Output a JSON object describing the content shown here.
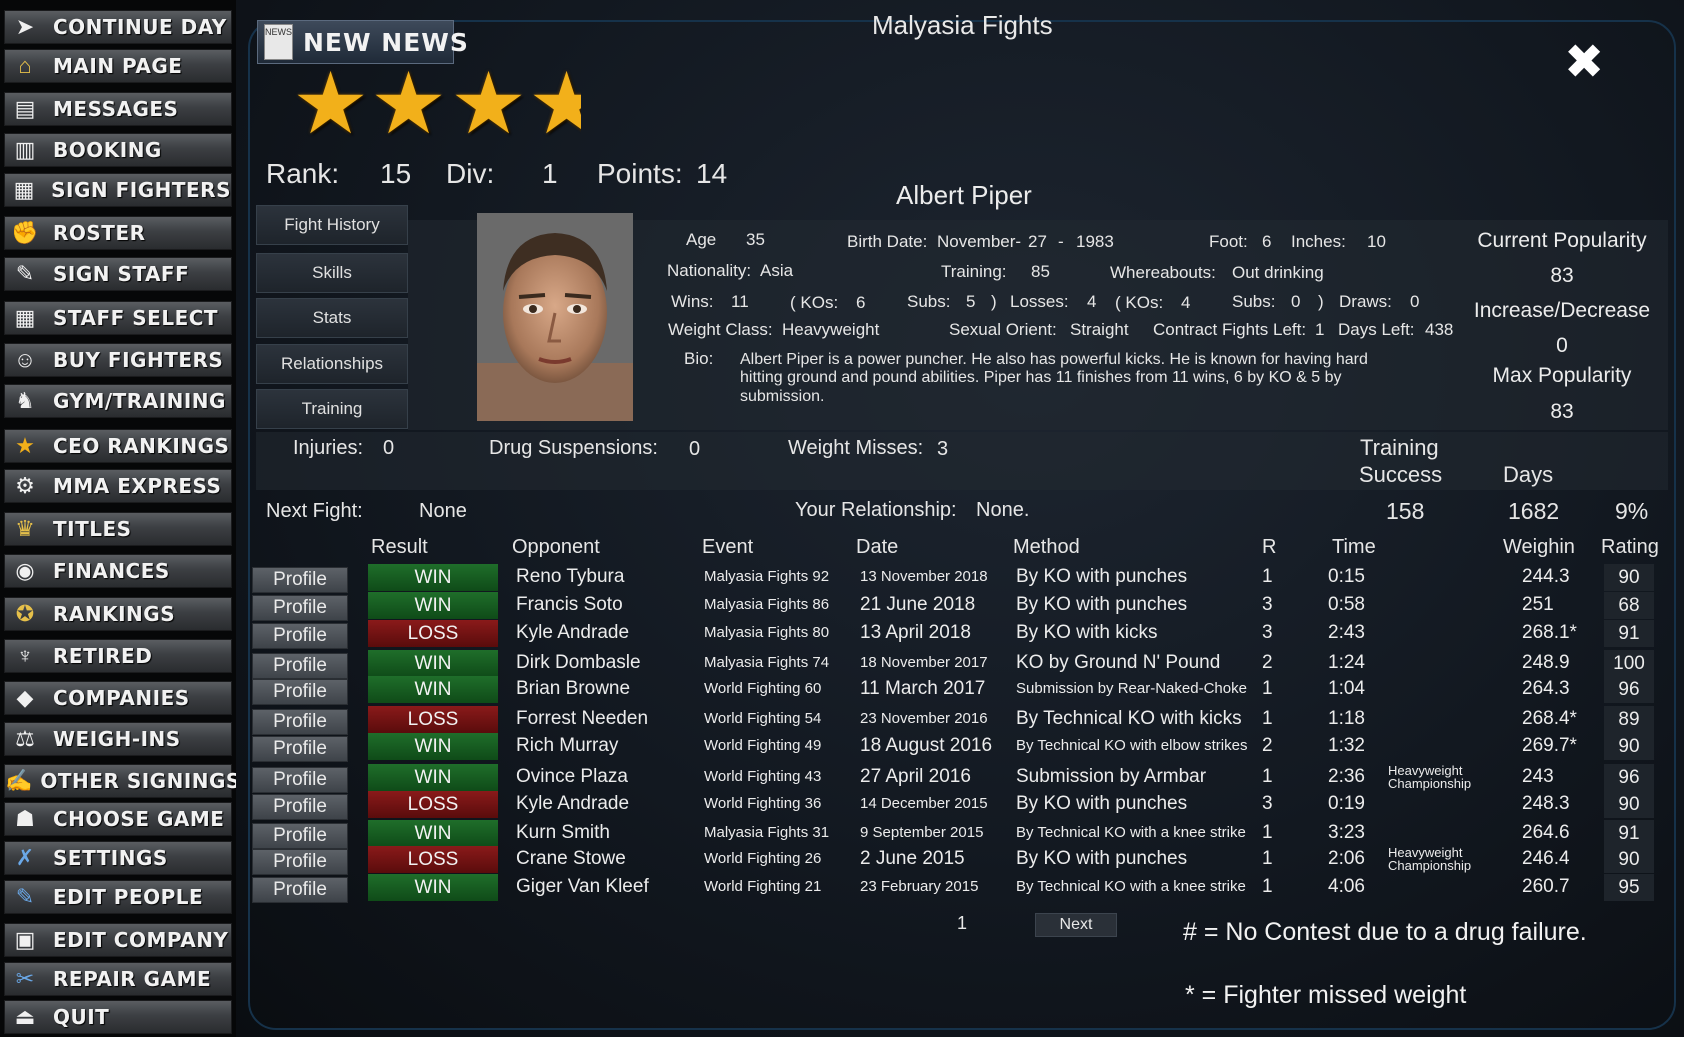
{
  "sidebar": [
    {
      "label": "CONTINUE DAY",
      "icon": "play-arrow-icon"
    },
    {
      "label": "MAIN PAGE",
      "icon": "home-icon"
    },
    {
      "label": "MESSAGES",
      "icon": "newspaper-icon"
    },
    {
      "label": "BOOKING",
      "icon": "clipboard-icon"
    },
    {
      "label": "SIGN FIGHTERS",
      "icon": "contract-icon"
    },
    {
      "label": "ROSTER",
      "icon": "fighter-icon"
    },
    {
      "label": "SIGN STAFF",
      "icon": "pen-icon"
    },
    {
      "label": "STAFF SELECT",
      "icon": "building-icon"
    },
    {
      "label": "BUY FIGHTERS",
      "icon": "portrait-icon"
    },
    {
      "label": "GYM/TRAINING",
      "icon": "gym-icon"
    },
    {
      "label": "CEO RANKINGS",
      "icon": "star-icon"
    },
    {
      "label": "MMA EXPRESS",
      "icon": "gear-icon"
    },
    {
      "label": "TITLES",
      "icon": "trophy-icon"
    },
    {
      "label": "FINANCES",
      "icon": "money-icon"
    },
    {
      "label": "RANKINGS",
      "icon": "medal-icon"
    },
    {
      "label": "RETIRED",
      "icon": "cocktail-icon"
    },
    {
      "label": "COMPANIES",
      "icon": "cube-icon"
    },
    {
      "label": "WEIGH-INS",
      "icon": "scale-icon"
    },
    {
      "label": "OTHER SIGNINGS",
      "icon": "signing-icon"
    },
    {
      "label": "CHOOSE GAME",
      "icon": "person-icon"
    },
    {
      "label": "SETTINGS",
      "icon": "wrench-icon"
    },
    {
      "label": "EDIT PEOPLE",
      "icon": "edit-icon"
    },
    {
      "label": "EDIT COMPANY",
      "icon": "company-icon"
    },
    {
      "label": "REPAIR GAME",
      "icon": "repair-icon"
    },
    {
      "label": "QUIT",
      "icon": "exit-icon"
    }
  ],
  "header": {
    "title": "Malyasia Fights",
    "news_label": "NEW NEWS",
    "news_icon_text": "NEWS"
  },
  "rating_stars": 4,
  "rank": {
    "rank_label": "Rank:",
    "rank": "15",
    "div_label": "Div:",
    "div": "1",
    "points_label": "Points:",
    "points": "14"
  },
  "fighter": {
    "name": "Albert Piper",
    "age_label": "Age",
    "age": "35",
    "birth_label": "Birth Date:",
    "birth_month": "November-",
    "birth_day": "27",
    "birth_sep": "-",
    "birth_year": "1983",
    "foot_label": "Foot:",
    "foot": "6",
    "inches_label": "Inches:",
    "inches": "10",
    "nationality_label": "Nationality:",
    "nationality": "Asia",
    "training_label": "Training:",
    "training": "85",
    "whereabouts_label": "Whereabouts:",
    "whereabouts": "Out drinking",
    "wins_label": "Wins:",
    "wins": "11",
    "wko_label": "( KOs:",
    "wko": "6",
    "wsub_label": "Subs:",
    "wsub": "5",
    "close_paren": ")",
    "losses_label": "Losses:",
    "losses": "4",
    "lko_label": "( KOs:",
    "lko": "4",
    "lsub_label": "Subs:",
    "lsub": "0",
    "draws_label": "Draws:",
    "draws": "0",
    "weightclass_label": "Weight Class:",
    "weightclass": "Heavyweight",
    "orient_label": "Sexual Orient:",
    "orient": "Straight",
    "contract_label": "Contract Fights Left:",
    "contract": "1",
    "days_label": "Days Left:",
    "days": "438",
    "bio_label": "Bio:",
    "bio_1": "Albert Piper is a power puncher. He also has powerful kicks. He is known for having hard",
    "bio_2": "hitting ground and pound abilities. Piper has 11 finishes from 11 wins, 6 by KO & 5 by",
    "bio_3": "submission."
  },
  "popularity": {
    "current_label": "Current Popularity",
    "current": "83",
    "change_label": "Increase/Decrease",
    "change": "0",
    "max_label": "Max Popularity",
    "max": "83"
  },
  "tabs": [
    "Fight History",
    "Skills",
    "Stats",
    "Relationships",
    "Training"
  ],
  "status": {
    "injuries_label": "Injuries:",
    "injuries": "0",
    "drug_label": "Drug Suspensions:",
    "drug": "0",
    "weight_label": "Weight Misses:",
    "weight": "3",
    "training_label_1": "Training",
    "training_label_2": "Success",
    "training_value": "158",
    "days_label": "Days",
    "days_value": "1682",
    "percent": "9%",
    "next_label": "Next Fight:",
    "next": "None",
    "relationship_label": "Your Relationship:",
    "relationship": "None."
  },
  "table": {
    "headers": [
      "Result",
      "Opponent",
      "Event",
      "Date",
      "Method",
      "R",
      "Time",
      "Weighin",
      "Rating"
    ],
    "profile_label": "Profile",
    "rows": [
      {
        "result": "WIN",
        "opponent": "Reno Tybura",
        "event": "Malyasia Fights 92",
        "date": "13 November 2018",
        "method": "By KO with punches",
        "r": "1",
        "time": "0:15",
        "title": "",
        "weighin": "244.3",
        "rating": "90"
      },
      {
        "result": "WIN",
        "opponent": "Francis Soto",
        "event": "Malyasia Fights 86",
        "date": "21 June 2018",
        "method": "By KO with punches",
        "r": "3",
        "time": "0:58",
        "title": "",
        "weighin": "251",
        "rating": "68"
      },
      {
        "result": "LOSS",
        "opponent": "Kyle Andrade",
        "event": "Malyasia Fights 80",
        "date": "13 April 2018",
        "method": "By KO with kicks",
        "r": "3",
        "time": "2:43",
        "title": "",
        "weighin": "268.1*",
        "rating": "91"
      },
      {
        "result": "WIN",
        "opponent": "Dirk Dombasle",
        "event": "Malyasia Fights 74",
        "date": "18 November 2017",
        "method": "KO by Ground N' Pound",
        "r": "2",
        "time": "1:24",
        "title": "",
        "weighin": "248.9",
        "rating": "100"
      },
      {
        "result": "WIN",
        "opponent": "Brian Browne",
        "event": "World Fighting 60",
        "date": "11 March 2017",
        "method": "Submission by Rear-Naked-Choke",
        "r": "1",
        "time": "1:04",
        "title": "",
        "weighin": "264.3",
        "rating": "96"
      },
      {
        "result": "LOSS",
        "opponent": "Forrest Needen",
        "event": "World Fighting 54",
        "date": "23 November 2016",
        "method": "By Technical KO with kicks",
        "r": "1",
        "time": "1:18",
        "title": "",
        "weighin": "268.4*",
        "rating": "89"
      },
      {
        "result": "WIN",
        "opponent": "Rich Murray",
        "event": "World Fighting 49",
        "date": "18 August 2016",
        "method": "By Technical KO with elbow strikes",
        "r": "2",
        "time": "1:32",
        "title": "",
        "weighin": "269.7*",
        "rating": "90"
      },
      {
        "result": "WIN",
        "opponent": "Ovince Plaza",
        "event": "World Fighting 43",
        "date": "27 April 2016",
        "method": "Submission by Armbar",
        "r": "1",
        "time": "2:36",
        "title": "Heavyweight Championship",
        "weighin": "243",
        "rating": "96"
      },
      {
        "result": "LOSS",
        "opponent": "Kyle Andrade",
        "event": "World Fighting 36",
        "date": "14 December 2015",
        "method": "By KO with punches",
        "r": "3",
        "time": "0:19",
        "title": "",
        "weighin": "248.3",
        "rating": "90"
      },
      {
        "result": "WIN",
        "opponent": "Kurn Smith",
        "event": "Malyasia Fights 31",
        "date": "9 September 2015",
        "method": "By Technical KO with a knee strike",
        "r": "1",
        "time": "3:23",
        "title": "",
        "weighin": "264.6",
        "rating": "91"
      },
      {
        "result": "LOSS",
        "opponent": "Crane Stowe",
        "event": "World Fighting 26",
        "date": "2 June 2015",
        "method": "By KO with punches",
        "r": "1",
        "time": "2:06",
        "title": "Heavyweight Championship",
        "weighin": "246.4",
        "rating": "90"
      },
      {
        "result": "WIN",
        "opponent": "Giger Van Kleef",
        "event": "World Fighting 21",
        "date": "23 February 2015",
        "method": "By Technical KO with a knee strike",
        "r": "1",
        "time": "4:06",
        "title": "",
        "weighin": "260.7",
        "rating": "95"
      }
    ]
  },
  "pager": {
    "page": "1",
    "next_label": "Next"
  },
  "notes": {
    "nc": "# = No Contest due to a drug failure.",
    "mw": "* = Fighter missed weight"
  },
  "close_label": "✖"
}
